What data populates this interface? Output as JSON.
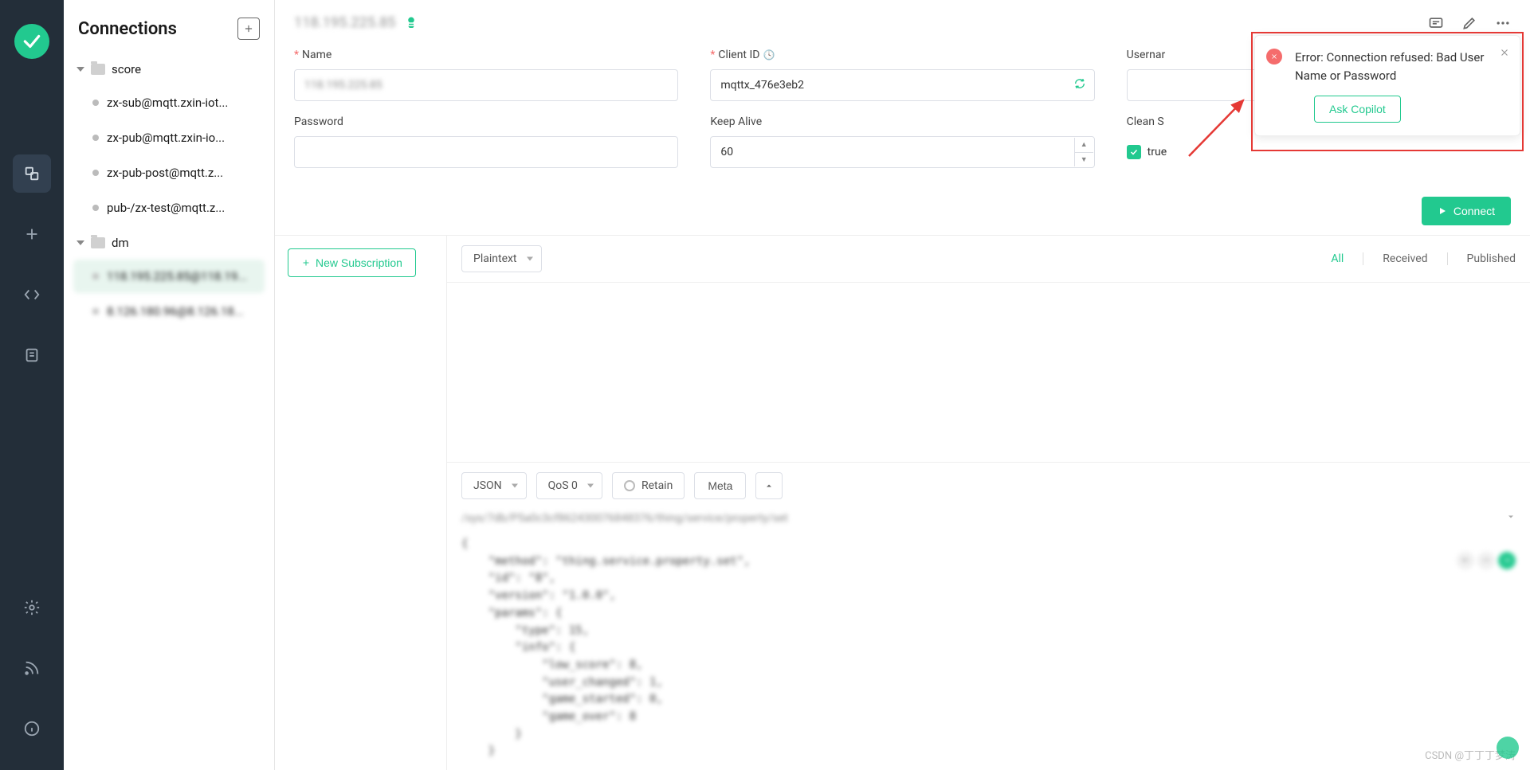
{
  "sidebar_title": "Connections",
  "tree": {
    "groups": [
      {
        "name": "score",
        "items": [
          {
            "label": "zx-sub@mqtt.zxin-iot..."
          },
          {
            "label": "zx-pub@mqtt.zxin-io..."
          },
          {
            "label": "zx-pub-post@mqtt.z..."
          },
          {
            "label": "pub-/zx-test@mqtt.z..."
          }
        ]
      },
      {
        "name": "dm",
        "items": [
          {
            "label": "118.195.225.85@118.19...",
            "blurred": true,
            "selected": true
          },
          {
            "label": "8.126.180.96@8.126.18...",
            "blurred": true
          }
        ]
      }
    ]
  },
  "header": {
    "host_title": "118.195.225.85"
  },
  "form": {
    "name_label": "Name",
    "name_value": "118.195.225.85",
    "clientid_label": "Client ID",
    "clientid_value": "mqttx_476e3eb2",
    "username_label": "Usernar",
    "username_value": "",
    "password_label": "Password",
    "password_value": "",
    "keepalive_label": "Keep Alive",
    "keepalive_value": "60",
    "cleansession_label": "Clean S",
    "cleansession_value": "true"
  },
  "connect_btn": "Connect",
  "new_sub_btn": "New Subscription",
  "msg_format": "Plaintext",
  "filters": {
    "all": "All",
    "received": "Received",
    "published": "Published"
  },
  "publish": {
    "payload_format": "JSON",
    "qos": "QoS 0",
    "retain": "Retain",
    "meta": "Meta",
    "topic": "/sys/7db/P5a0c3cf862430076848376/thing/service/property/set",
    "payload_lines": [
      "{",
      "    \"method\": \"thing.service.property.set\",",
      "    \"id\": \"8\",",
      "    \"version\": \"1.0.0\",",
      "    \"params\": {",
      "        \"type\": 15,",
      "        \"info\": {",
      "            \"low_score\": 8,",
      "            \"user_changed\": 1,",
      "            \"game_started\": 0,",
      "            \"game_over\": 8",
      "        }",
      "    }"
    ]
  },
  "error": {
    "message": "Error: Connection refused: Bad User Name or Password",
    "ask_copilot": "Ask Copilot"
  },
  "watermark": "CSDN @丁丁丁梦涛"
}
